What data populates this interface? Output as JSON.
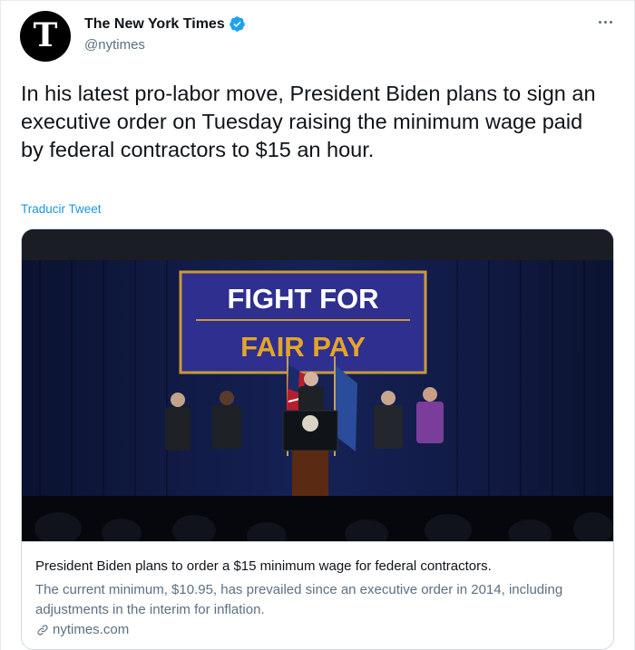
{
  "account": {
    "display_name": "The New York Times",
    "handle": "@nytimes",
    "avatar_letter": "T"
  },
  "tweet": {
    "text": "In his latest pro-labor move, President Biden plans to sign an executive order on Tuesday raising the minimum wage paid by federal contractors to $15 an hour.",
    "translate_label": "Traducir Tweet"
  },
  "card": {
    "banner_line1": "FIGHT FOR",
    "banner_line2": "FAIR PAY",
    "title": "President Biden plans to order a $15 minimum wage for federal contractors.",
    "description": "The current minimum, $10.95, has prevailed since an executive order in 2014, including adjustments in the interim for inflation.",
    "domain": "nytimes.com"
  },
  "icons": {
    "verified": "verified-badge-icon",
    "more": "more-options-icon",
    "link": "link-icon"
  },
  "colors": {
    "link_blue": "#1b95e0",
    "verified_blue": "#1da1f2",
    "secondary_text": "#5b7083",
    "banner_blue": "#2e2f8f",
    "banner_gold": "#e3a52a"
  }
}
